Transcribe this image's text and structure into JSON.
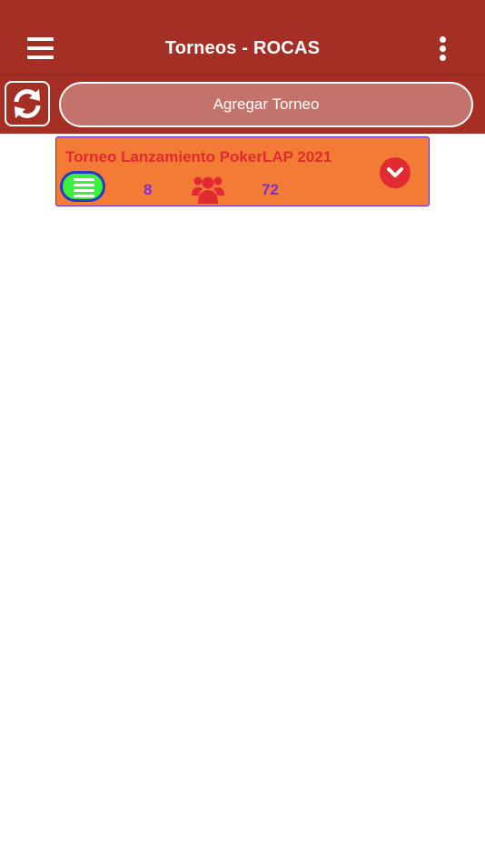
{
  "header": {
    "title": "Torneos - ROCAS",
    "menu_icon": "hamburger-menu-icon",
    "more_icon": "more-vertical-icon"
  },
  "toolbar": {
    "refresh_icon": "refresh-icon",
    "add_label": "Agregar Torneo"
  },
  "tournaments": [
    {
      "name": "Torneo Lanzamiento PokerLAP 2021",
      "list_icon": "list-icon",
      "tables_count": "8",
      "players_icon": "users-group-icon",
      "players_count": "72",
      "expand_icon": "chevron-down-icon"
    }
  ],
  "colors": {
    "header_bg": "#a52f24",
    "add_button_bg": "#c4736c",
    "card_bg": "#f37b36",
    "card_title": "#e12a32",
    "count_text": "#7b2fd8",
    "list_button_bg": "#3cf13c",
    "list_button_border": "#2738c6"
  }
}
